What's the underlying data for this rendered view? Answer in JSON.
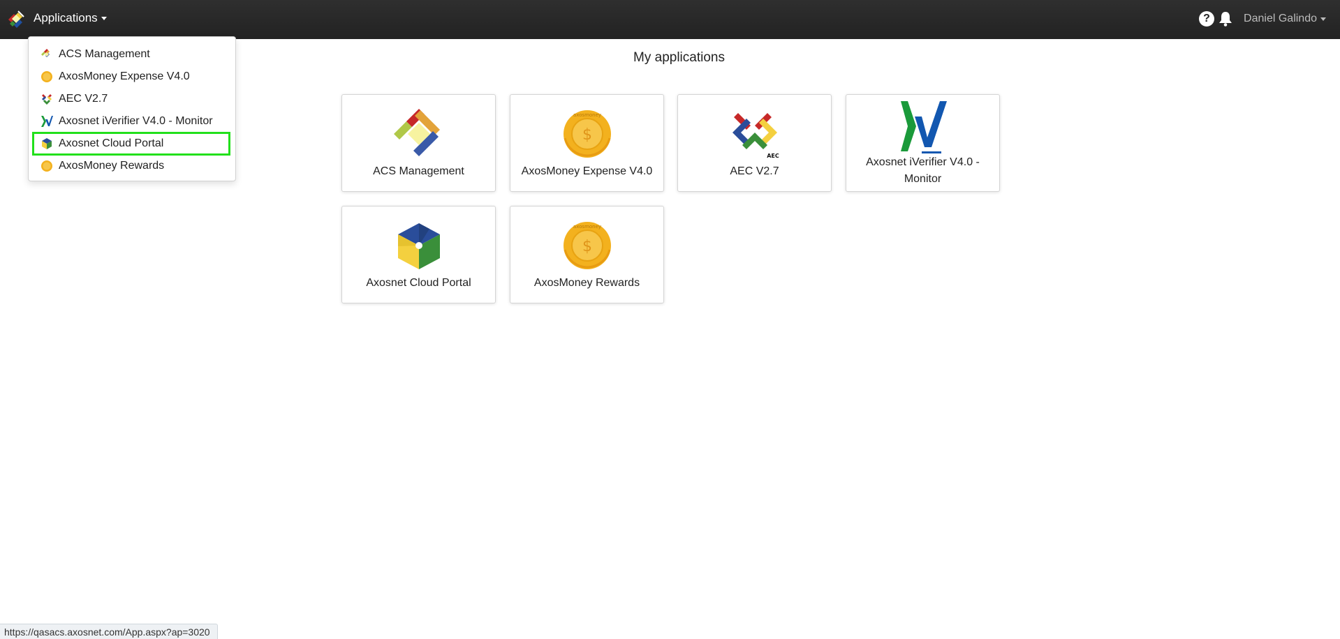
{
  "navbar": {
    "apps_label": "Applications",
    "help_label": "?",
    "user_name": "Daniel Galindo"
  },
  "dropdown": {
    "items": [
      {
        "label": "ACS Management",
        "icon": "acs-icon"
      },
      {
        "label": "AxosMoney Expense V4.0",
        "icon": "coin-icon"
      },
      {
        "label": "AEC V2.7",
        "icon": "aec-icon"
      },
      {
        "label": "Axosnet iVerifier V4.0 - Monitor",
        "icon": "iverifier-icon"
      },
      {
        "label": "Axosnet Cloud Portal",
        "icon": "cube-icon"
      },
      {
        "label": "AxosMoney Rewards",
        "icon": "coin-icon"
      }
    ]
  },
  "main": {
    "title": "My applications",
    "cards": [
      {
        "label": "ACS Management"
      },
      {
        "label": "AxosMoney Expense V4.0"
      },
      {
        "label": "AEC V2.7"
      },
      {
        "label": "Axosnet iVerifier V4.0 - Monitor"
      },
      {
        "label": "Axosnet Cloud Portal"
      },
      {
        "label": "AxosMoney Rewards"
      }
    ],
    "coin_text": "axosmoney",
    "coin_symbol": "$",
    "aec_badge": "AEC"
  },
  "status_bar": {
    "url": "https://qasacs.axosnet.com/App.aspx?ap=3020"
  },
  "colors": {
    "navbar": "#2a2a2a",
    "highlight": "#22e01b",
    "coin": "#f3b11e"
  }
}
